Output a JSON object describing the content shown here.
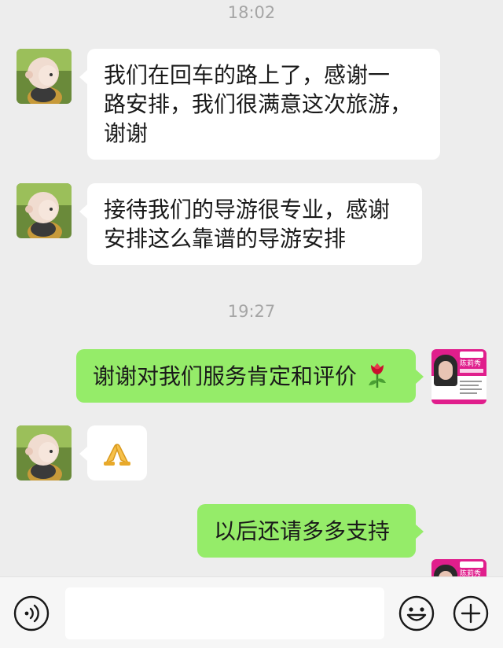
{
  "timestamps": [
    "18:02",
    "19:27"
  ],
  "messages": [
    {
      "side": "in",
      "lines": [
        "我们在回车的路上了，感谢一",
        "路安排，我们很满意这次旅游，",
        "谢谢"
      ]
    },
    {
      "side": "in",
      "lines": [
        "接待我们的导游很专业，感谢",
        "安排这么靠谱的导游安排"
      ]
    },
    {
      "side": "out",
      "lines": [
        "谢谢对我们服务肯定和评价"
      ],
      "emoji": "rose"
    },
    {
      "side": "in",
      "emoji": "folded-hands"
    },
    {
      "side": "out",
      "lines": [
        "以后还请多多支持"
      ]
    }
  ],
  "agent_card": {
    "name": "陈莉秀"
  },
  "input_bar": {
    "placeholder": "",
    "icons": [
      "voice-icon",
      "emoji-icon",
      "plus-icon"
    ]
  },
  "colors": {
    "background": "#ededed",
    "incoming_bubble": "#ffffff",
    "outgoing_bubble": "#95ec69",
    "timestamp": "#a5a5a5",
    "card_accent": "#e01e8c"
  }
}
